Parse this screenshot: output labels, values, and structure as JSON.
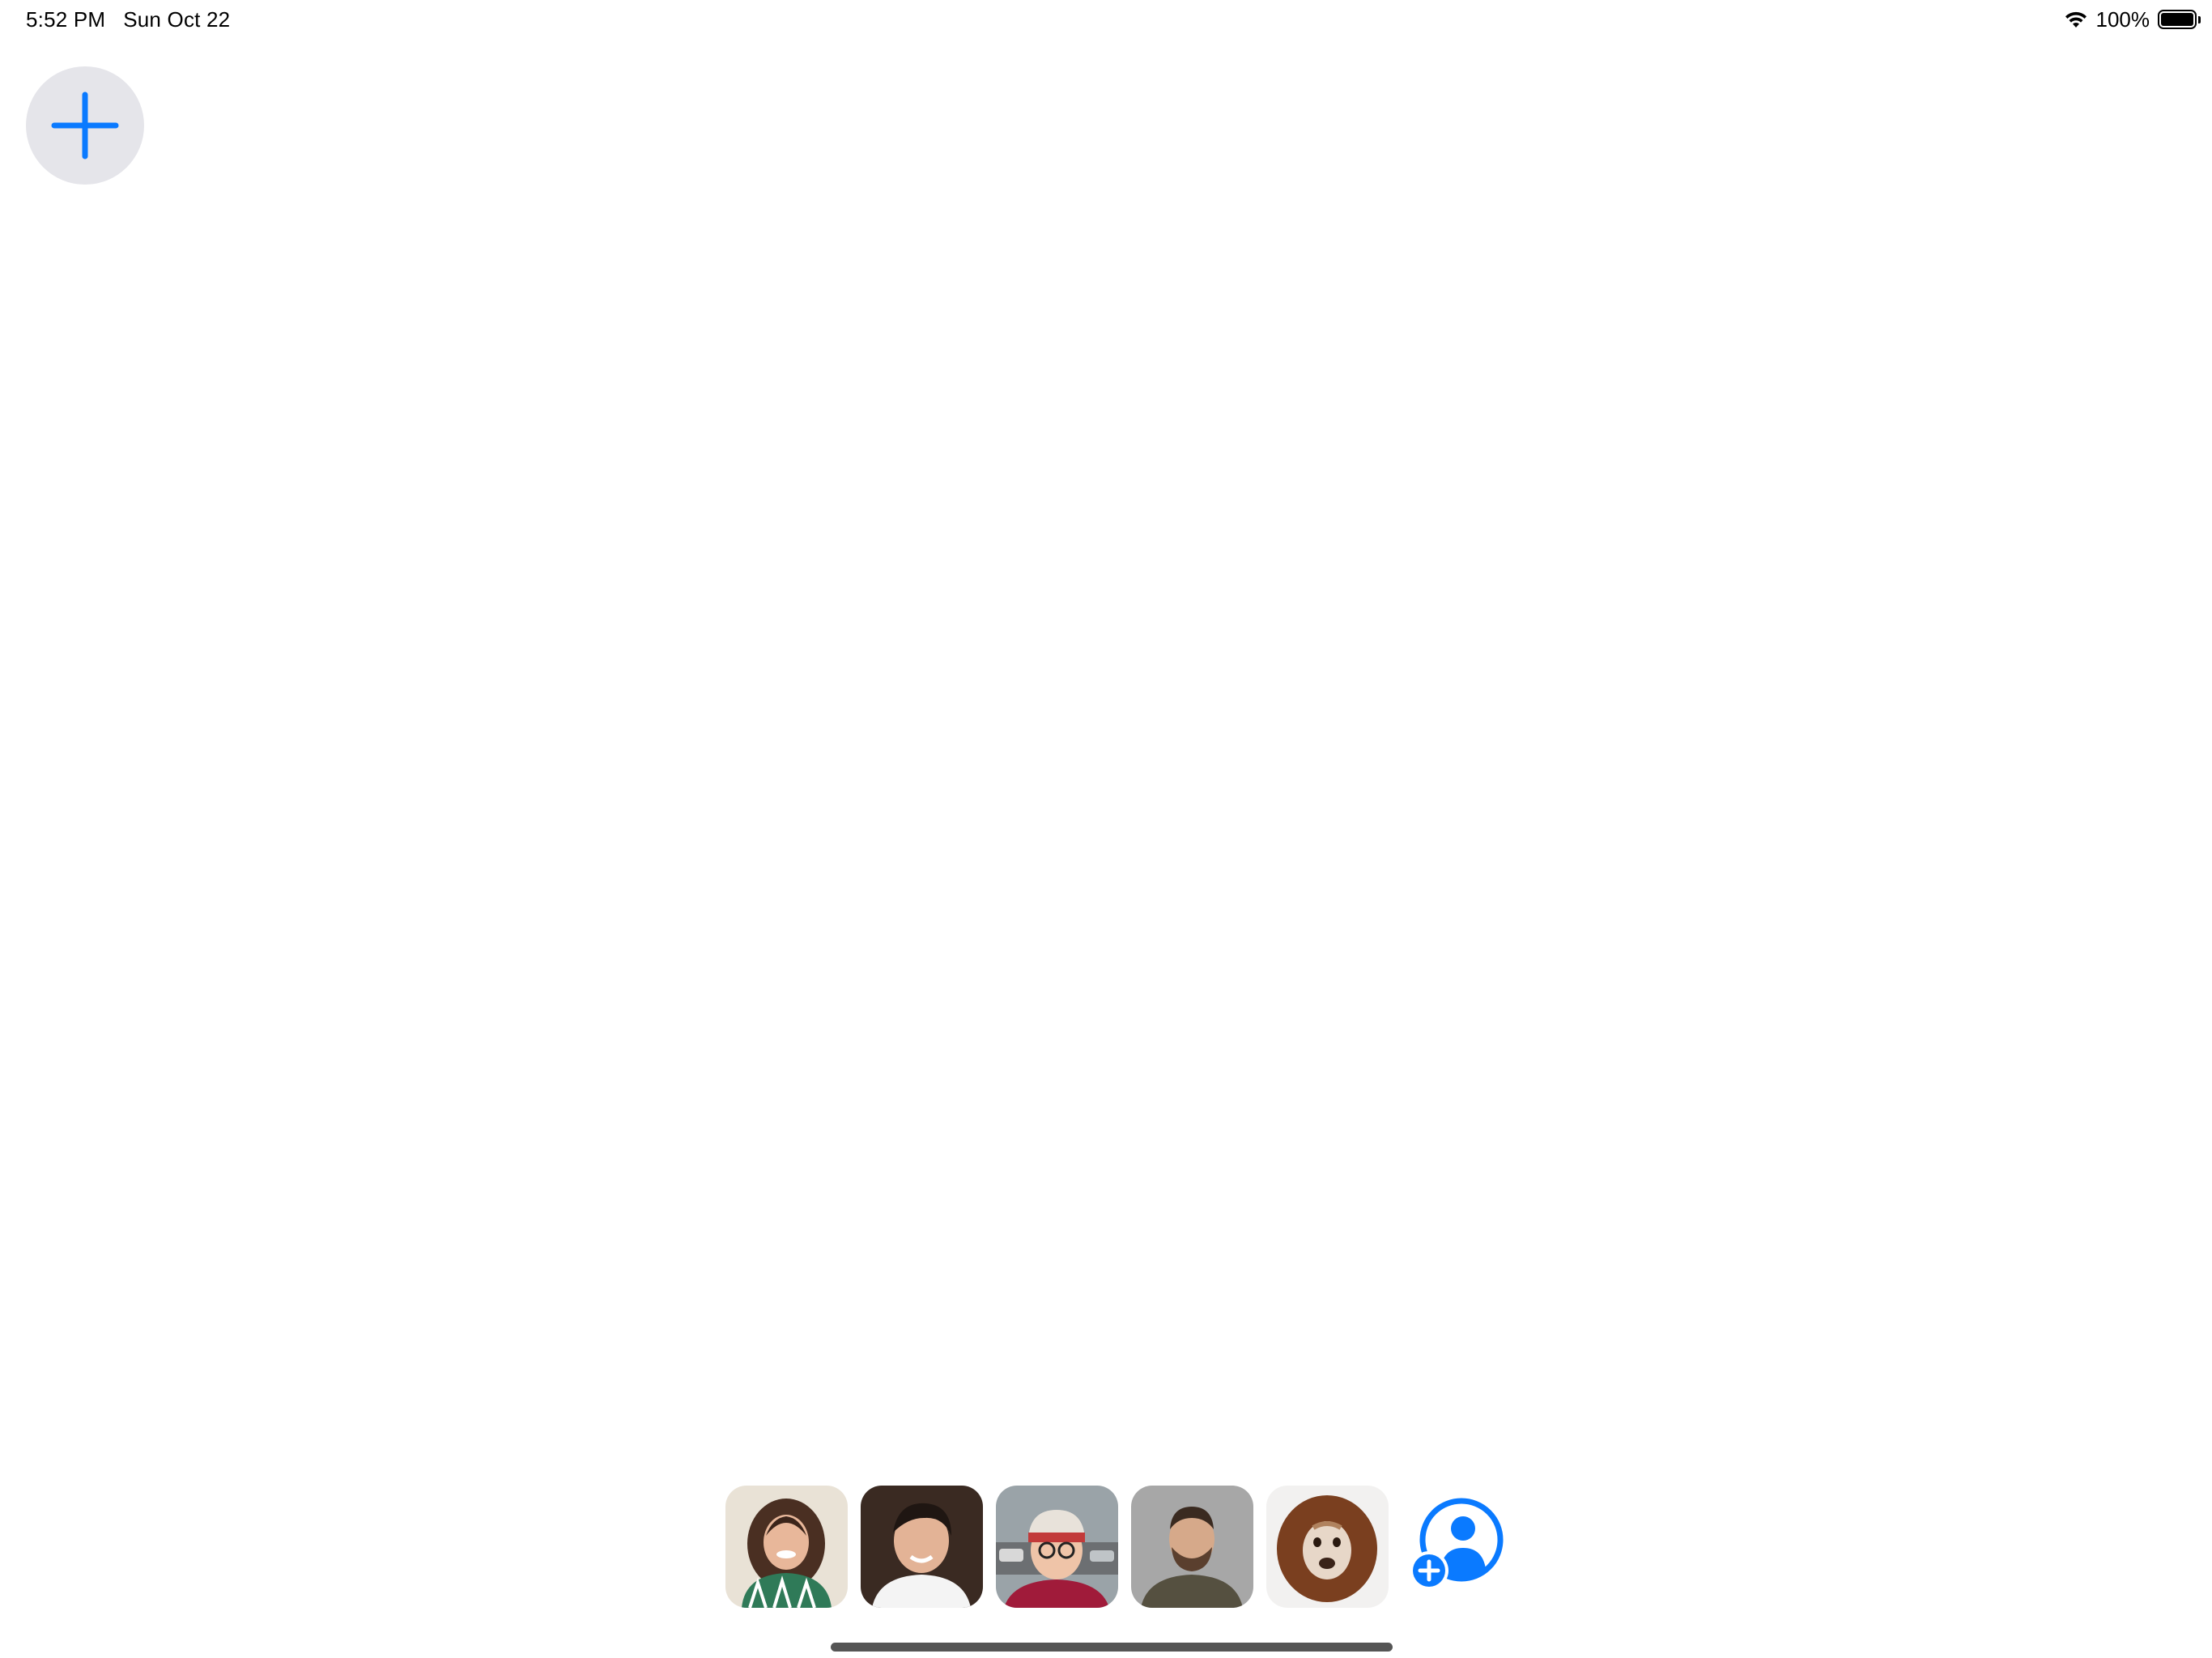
{
  "status_bar": {
    "time": "5:52 PM",
    "date": "Sun Oct 22",
    "battery_text": "100%",
    "battery_level": 1.0,
    "wifi_icon": "wifi-icon",
    "battery_icon": "battery-icon"
  },
  "add_button": {
    "icon": "plus-icon",
    "accent_color": "#0a7aff",
    "background_color": "#e5e5ea"
  },
  "contacts": [
    {
      "avatar": "woman-curly-hair-photo",
      "bg": "#e9e2d6"
    },
    {
      "avatar": "young-man-smiling-photo",
      "bg": "#3a2a22"
    },
    {
      "avatar": "woman-beanie-glasses-photo",
      "bg": "#9aa3a8"
    },
    {
      "avatar": "bearded-man-photo",
      "bg": "#a7a7a7"
    },
    {
      "avatar": "dog-lion-costume-photo",
      "bg": "#f2f1f0"
    }
  ],
  "add_person_button": {
    "icon": "add-person-icon",
    "color": "#0a7aff"
  }
}
